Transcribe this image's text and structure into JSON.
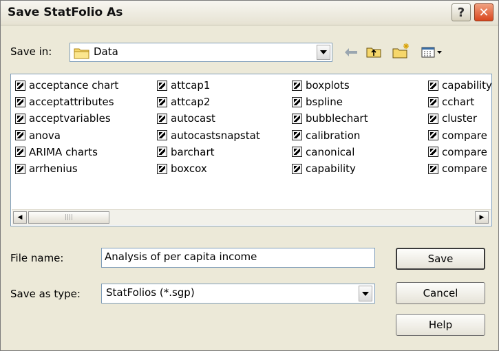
{
  "window": {
    "title": "Save StatFolio As",
    "help_glyph": "?",
    "close_glyph": "✕"
  },
  "save_in": {
    "label": "Save in:",
    "value": "Data"
  },
  "files": {
    "columns": [
      [
        "acceptance chart",
        "acceptattributes",
        "acceptvariables",
        "anova",
        "ARIMA charts",
        "arrhenius"
      ],
      [
        "attcap1",
        "attcap2",
        "autocast",
        "autocastsnapstat",
        "barchart",
        "boxcox"
      ],
      [
        "boxplots",
        "bspline",
        "bubblechart",
        "calibration",
        "canonical",
        "capability"
      ],
      [
        "capability",
        "cchart",
        "cluster",
        "compare",
        "compare",
        "compare"
      ]
    ]
  },
  "scrollbar": {
    "left_glyph": "◀",
    "right_glyph": "▶",
    "thumb_grip": "||||"
  },
  "file_name": {
    "label": "File name:",
    "value": "Analysis of per capita income"
  },
  "save_as_type": {
    "label": "Save as type:",
    "value": "StatFolios (*.sgp)"
  },
  "buttons": {
    "save": "Save",
    "cancel": "Cancel",
    "help": "Help"
  }
}
